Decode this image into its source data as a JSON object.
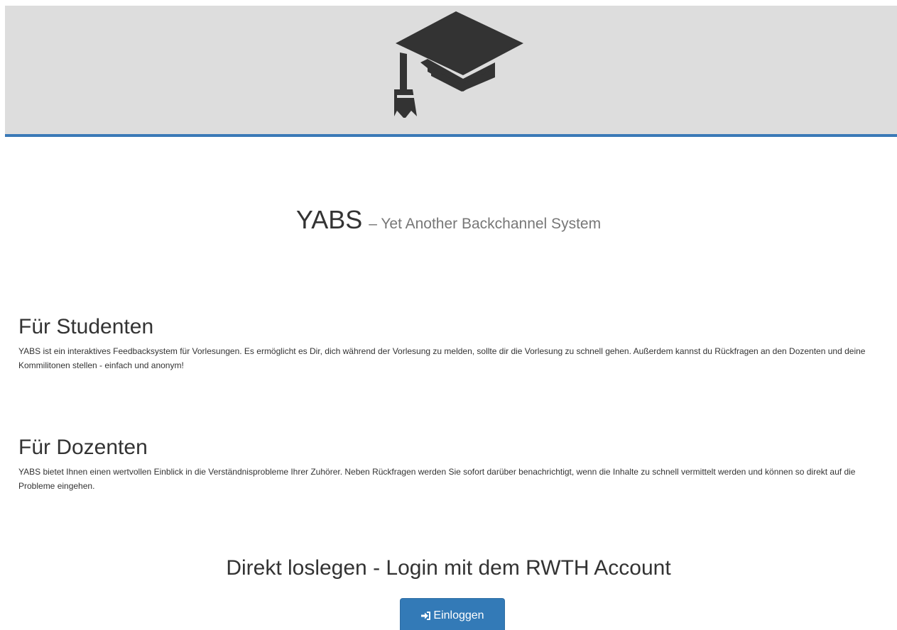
{
  "header": {
    "logo_icon": "graduation-cap-icon",
    "banner_color": "#dddddd",
    "accent_border_color": "#3a79b7"
  },
  "hero": {
    "title": "YABS",
    "subtitle": "– Yet Another Backchannel System"
  },
  "sections": [
    {
      "heading": "Für Studenten",
      "body": "YABS ist ein interaktives Feedbacksystem für Vorlesungen. Es ermöglicht es Dir, dich während der Vorlesung zu melden, sollte dir die Vorlesung zu schnell gehen. Außerdem kannst du Rückfragen an den Dozenten und deine Kommilitonen stellen - einfach und anonym!"
    },
    {
      "heading": "Für Dozenten",
      "body": "YABS bietet Ihnen einen wertvollen Einblick in die Verständnisprobleme Ihrer Zuhörer. Neben Rückfragen werden Sie sofort darüber benachrichtigt, wenn die Inhalte zu schnell vermittelt werden und können so direkt auf die Probleme eingehen."
    }
  ],
  "cta": {
    "title": "Direkt loslegen - Login mit dem RWTH Account",
    "button_label": "Einloggen",
    "button_icon": "log-in-icon",
    "button_color": "#337ab7"
  }
}
